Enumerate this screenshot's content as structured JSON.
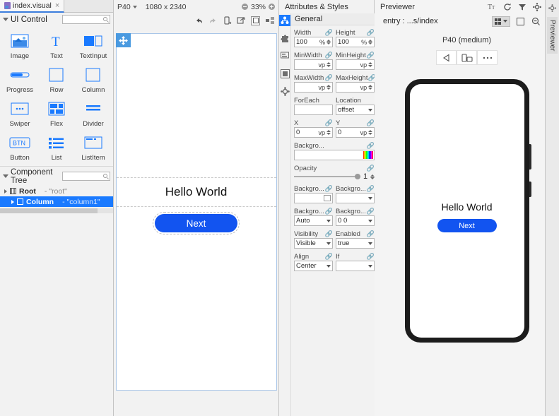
{
  "editor_tab": {
    "title": "index.visual",
    "icon": "file-visual-icon",
    "close": "×"
  },
  "ui_control": {
    "title": "UI Control",
    "search_placeholder": "",
    "search_value": "",
    "items": [
      {
        "label": "Image",
        "icon": "image-icon"
      },
      {
        "label": "Text",
        "icon": "text-icon"
      },
      {
        "label": "TextInput",
        "icon": "textinput-icon"
      },
      {
        "label": "Progress",
        "icon": "progress-icon"
      },
      {
        "label": "Row",
        "icon": "row-icon"
      },
      {
        "label": "Column",
        "icon": "column-icon"
      },
      {
        "label": "Swiper",
        "icon": "swiper-icon"
      },
      {
        "label": "Flex",
        "icon": "flex-icon"
      },
      {
        "label": "Divider",
        "icon": "divider-icon"
      },
      {
        "label": "Button",
        "icon": "button-icon"
      },
      {
        "label": "List",
        "icon": "list-icon"
      },
      {
        "label": "ListItem",
        "icon": "listitem-icon"
      }
    ]
  },
  "component_tree": {
    "title": "Component Tree",
    "search_value": "",
    "nodes": [
      {
        "name": "Root",
        "id": "- \"root\"",
        "selected": false
      },
      {
        "name": "Column",
        "id": "- \"column1\"",
        "selected": true
      }
    ]
  },
  "canvas": {
    "device": "P40",
    "resolution": "1080 x 2340",
    "zoom": "33%",
    "zoom_out_icon": "zoom-out-icon",
    "zoom_in_icon": "zoom-in-icon",
    "tools": [
      {
        "name": "undo-icon",
        "enabled": true
      },
      {
        "name": "redo-icon",
        "enabled": false
      },
      {
        "name": "device-icon",
        "enabled": true
      },
      {
        "name": "layers-icon",
        "enabled": true
      },
      {
        "name": "frame-icon",
        "enabled": true,
        "active": true
      },
      {
        "name": "grid-icon",
        "enabled": true
      }
    ],
    "hello_text": "Hello World",
    "button_label": "Next",
    "move_handle_icon": "move-handle-icon"
  },
  "attributes": {
    "title": "Attributes & Styles",
    "group": "General",
    "rail": [
      {
        "name": "hierarchy-icon",
        "active": true
      },
      {
        "name": "puzzle-icon",
        "active": false
      },
      {
        "name": "form-icon",
        "active": false
      },
      {
        "name": "square-icon",
        "active": false
      },
      {
        "name": "gear-icon",
        "active": false
      }
    ],
    "fields": {
      "width": {
        "label": "Width",
        "value": "100",
        "unit": "%"
      },
      "height": {
        "label": "Height",
        "value": "100",
        "unit": "%"
      },
      "min_width": {
        "label": "MinWidth",
        "value": "",
        "unit": "vp"
      },
      "min_height": {
        "label": "MinHeight",
        "value": "",
        "unit": "vp"
      },
      "max_width": {
        "label": "MaxWidth",
        "value": "",
        "unit": "vp"
      },
      "max_height": {
        "label": "MaxHeight",
        "value": "",
        "unit": "vp"
      },
      "for_each": {
        "label": "ForEach",
        "value": ""
      },
      "location": {
        "label": "Location",
        "value": "offset"
      },
      "x": {
        "label": "X",
        "value": "0",
        "unit": "vp"
      },
      "y": {
        "label": "Y",
        "value": "0",
        "unit": "vp"
      },
      "bg_color": {
        "label": "Backgro...",
        "value": ""
      },
      "opacity": {
        "label": "Opacity",
        "value": "1"
      },
      "bg_image": {
        "label": "Backgro...",
        "value": ""
      },
      "bg_repeat": {
        "label": "Backgro...",
        "value": ""
      },
      "bg_size": {
        "label": "Backgro...",
        "value": "Auto"
      },
      "bg_position": {
        "label": "Backgro...",
        "value": "0 0"
      },
      "visibility": {
        "label": "Visibility",
        "value": "Visible"
      },
      "enabled": {
        "label": "Enabled",
        "value": "true"
      },
      "align": {
        "label": "Align",
        "value": "Center"
      },
      "if": {
        "label": "If",
        "value": ""
      }
    }
  },
  "previewer": {
    "title": "Previewer",
    "header_icons": [
      "text-size-icon",
      "refresh-icon",
      "filter-icon",
      "settings-icon",
      "minimize-icon"
    ],
    "breadcrumb": "entry : ...s/index",
    "bar_icons": [
      "multi-profile-icon",
      "dropdown-icon",
      "fit-screen-icon",
      "zoom-out-icon",
      "zoom-in-icon"
    ],
    "device_label": "P40 (medium)",
    "device_buttons": [
      "back-icon",
      "rotate-icon",
      "more-icon"
    ],
    "screen": {
      "hello_text": "Hello World",
      "button_label": "Next"
    },
    "side_tab": "Previewer"
  },
  "colors": {
    "accent": "#1254f0",
    "selection": "#1a7aff",
    "frame_border": "#a9c6e8"
  }
}
